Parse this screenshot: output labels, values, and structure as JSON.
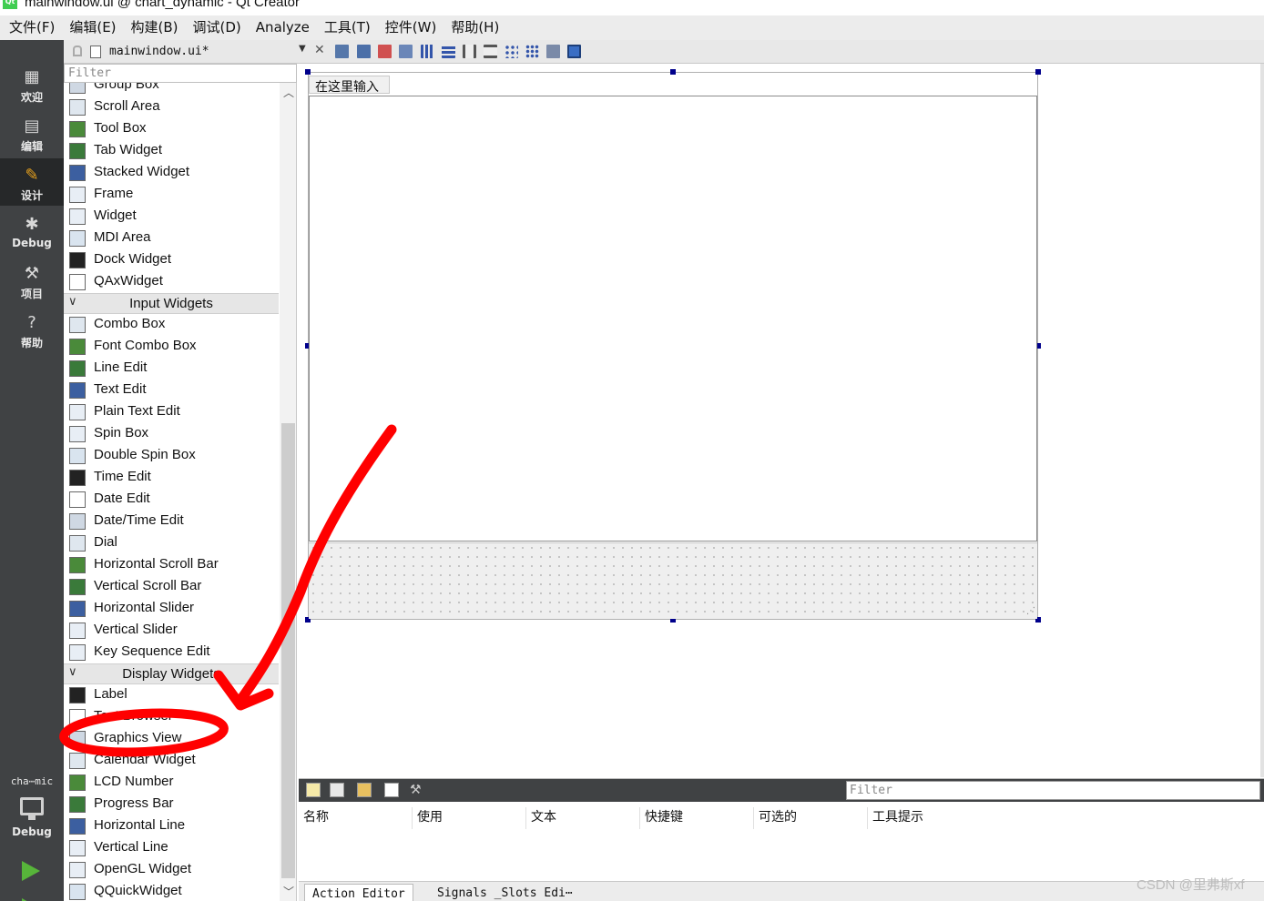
{
  "window": {
    "title": "mainwindow.ui @ chart_dynamic - Qt Creator"
  },
  "menubar": {
    "items": [
      "文件(F)",
      "编辑(E)",
      "构建(B)",
      "调试(D)",
      "Analyze",
      "工具(T)",
      "控件(W)",
      "帮助(H)"
    ]
  },
  "modes": [
    {
      "label": "欢迎",
      "icon": "grid-icon"
    },
    {
      "label": "编辑",
      "icon": "document-icon"
    },
    {
      "label": "设计",
      "icon": "pencil-icon"
    },
    {
      "label": "Debug",
      "icon": "bug-icon"
    },
    {
      "label": "项目",
      "icon": "wrench-icon"
    },
    {
      "label": "帮助",
      "icon": "help-icon"
    }
  ],
  "kit": {
    "project_label": "cha⋯mic",
    "build_label": "Debug"
  },
  "editor": {
    "filename": "mainwindow.ui*"
  },
  "widgetbox": {
    "filter_placeholder": "Filter",
    "items": [
      {
        "kind": "item",
        "label": "Group Box"
      },
      {
        "kind": "item",
        "label": "Scroll Area"
      },
      {
        "kind": "item",
        "label": "Tool Box"
      },
      {
        "kind": "item",
        "label": "Tab Widget"
      },
      {
        "kind": "item",
        "label": "Stacked Widget"
      },
      {
        "kind": "item",
        "label": "Frame"
      },
      {
        "kind": "item",
        "label": "Widget"
      },
      {
        "kind": "item",
        "label": "MDI Area"
      },
      {
        "kind": "item",
        "label": "Dock Widget"
      },
      {
        "kind": "item",
        "label": "QAxWidget"
      },
      {
        "kind": "category",
        "label": "Input Widgets"
      },
      {
        "kind": "item",
        "label": "Combo Box"
      },
      {
        "kind": "item",
        "label": "Font Combo Box"
      },
      {
        "kind": "item",
        "label": "Line Edit"
      },
      {
        "kind": "item",
        "label": "Text Edit"
      },
      {
        "kind": "item",
        "label": "Plain Text Edit"
      },
      {
        "kind": "item",
        "label": "Spin Box"
      },
      {
        "kind": "item",
        "label": "Double Spin Box"
      },
      {
        "kind": "item",
        "label": "Time Edit"
      },
      {
        "kind": "item",
        "label": "Date Edit"
      },
      {
        "kind": "item",
        "label": "Date/Time Edit"
      },
      {
        "kind": "item",
        "label": "Dial"
      },
      {
        "kind": "item",
        "label": "Horizontal Scroll Bar"
      },
      {
        "kind": "item",
        "label": "Vertical Scroll Bar"
      },
      {
        "kind": "item",
        "label": "Horizontal Slider"
      },
      {
        "kind": "item",
        "label": "Vertical Slider"
      },
      {
        "kind": "item",
        "label": "Key Sequence Edit"
      },
      {
        "kind": "category",
        "label": "Display Widgets"
      },
      {
        "kind": "item",
        "label": "Label"
      },
      {
        "kind": "item",
        "label": "Text Browser"
      },
      {
        "kind": "item",
        "label": "Graphics View"
      },
      {
        "kind": "item",
        "label": "Calendar Widget"
      },
      {
        "kind": "item",
        "label": "LCD Number"
      },
      {
        "kind": "item",
        "label": "Progress Bar"
      },
      {
        "kind": "item",
        "label": "Horizontal Line"
      },
      {
        "kind": "item",
        "label": "Vertical Line"
      },
      {
        "kind": "item",
        "label": "OpenGL Widget"
      },
      {
        "kind": "item",
        "label": "QQuickWidget"
      }
    ]
  },
  "form": {
    "input_text": "在这里输入"
  },
  "action_editor": {
    "filter_placeholder": "Filter",
    "columns": [
      "名称",
      "使用",
      "文本",
      "快捷键",
      "可选的",
      "工具提示"
    ],
    "tabs": [
      "Action Editor",
      "Signals _Slots Edi⋯"
    ]
  },
  "watermark": "CSDN @里弗斯xf",
  "colors": {
    "modebar_bg": "#404244",
    "annotation_red": "#ff0000",
    "selection_handle": "#00008b",
    "run_green": "#57b53a"
  }
}
